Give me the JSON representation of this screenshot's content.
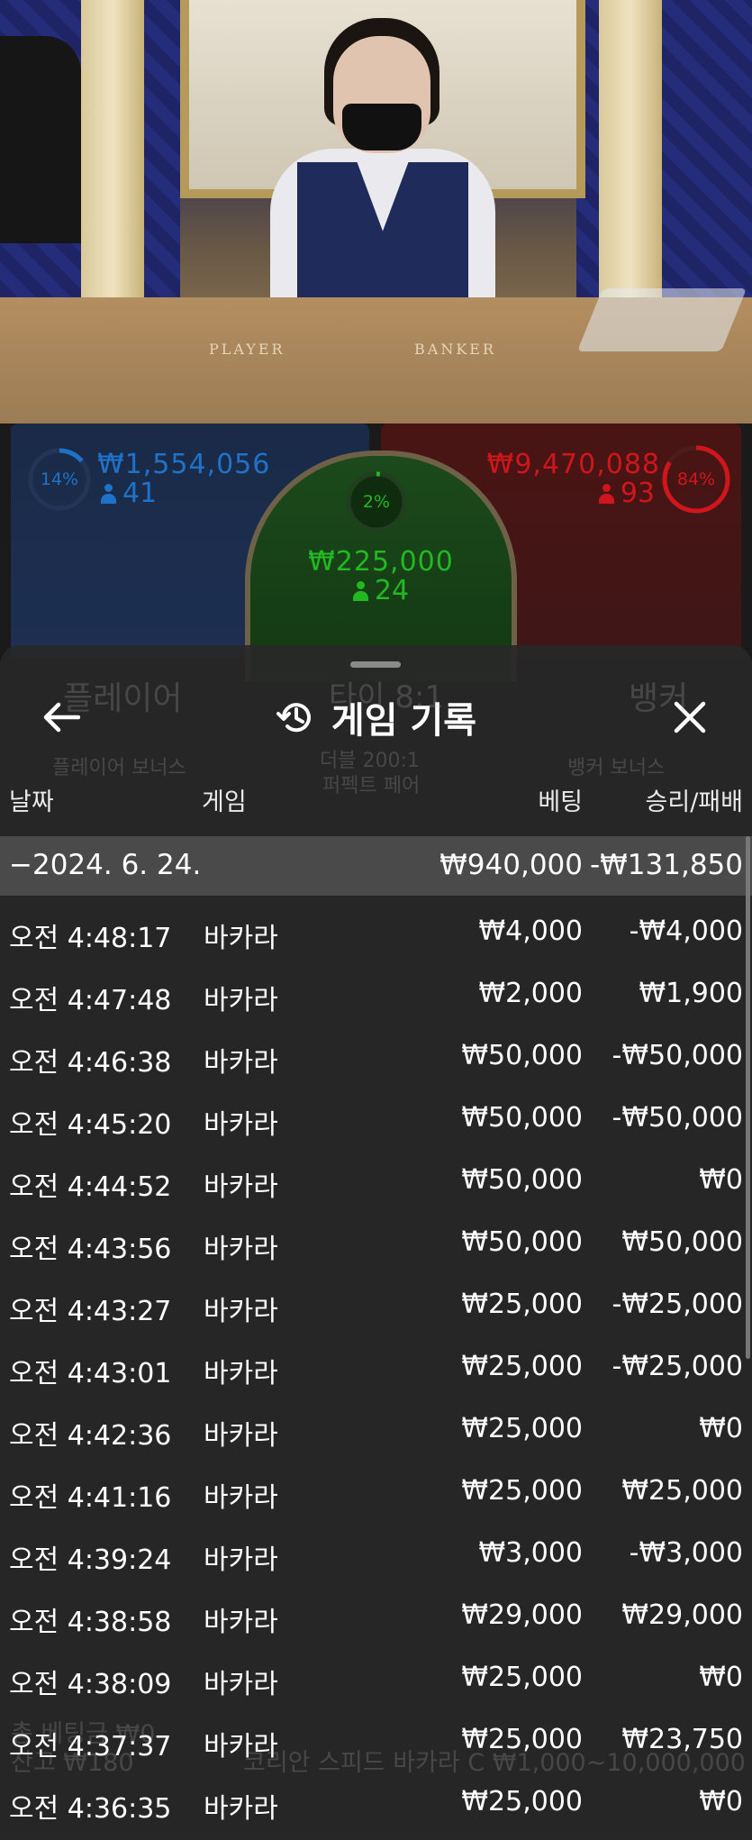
{
  "video": {
    "table_labels": {
      "player": "PLAYER",
      "banker": "BANKER"
    }
  },
  "bets": {
    "player": {
      "percent": "14%",
      "percent_value": 14,
      "amount": "₩1,554,056",
      "players": "41",
      "color": "#1e73c8"
    },
    "tie": {
      "percent": "2%",
      "percent_value": 2,
      "amount": "₩225,000",
      "players": "24",
      "color": "#22b822"
    },
    "banker": {
      "percent": "84%",
      "percent_value": 84,
      "amount": "₩9,470,088",
      "players": "93",
      "color": "#d0161c"
    }
  },
  "background_ui": {
    "player_label": "플레이어",
    "tie_label": "타이 8:1",
    "banker_label": "뱅커",
    "player_bonus": "플레이어 보너스",
    "perfect_pair": "퍼펙트 페어",
    "either_pair": "더블 200:1",
    "banker_bonus": "뱅커 보너스",
    "total_bet": "총 베팅금 ₩0",
    "balance": "잔고 ₩180",
    "table_name": "코리안 스피드 바카라 C ₩1,000~10,000,000"
  },
  "sheet": {
    "title": "게임 기록",
    "icons": {
      "back": "arrow-left-icon",
      "history": "history-icon",
      "close": "close-icon"
    },
    "columns": {
      "date": "날짜",
      "game": "게임",
      "bet": "베팅",
      "result": "승리/패배"
    },
    "date_group": {
      "label": "−2024. 6. 24.",
      "bet": "₩940,000",
      "result": "-₩131,850"
    },
    "rows": [
      {
        "time": "오전 4:48:17",
        "game": "바카라",
        "bet": "₩4,000",
        "result": "-₩4,000"
      },
      {
        "time": "오전 4:47:48",
        "game": "바카라",
        "bet": "₩2,000",
        "result": "₩1,900"
      },
      {
        "time": "오전 4:46:38",
        "game": "바카라",
        "bet": "₩50,000",
        "result": "-₩50,000"
      },
      {
        "time": "오전 4:45:20",
        "game": "바카라",
        "bet": "₩50,000",
        "result": "-₩50,000"
      },
      {
        "time": "오전 4:44:52",
        "game": "바카라",
        "bet": "₩50,000",
        "result": "₩0"
      },
      {
        "time": "오전 4:43:56",
        "game": "바카라",
        "bet": "₩50,000",
        "result": "₩50,000"
      },
      {
        "time": "오전 4:43:27",
        "game": "바카라",
        "bet": "₩25,000",
        "result": "-₩25,000"
      },
      {
        "time": "오전 4:43:01",
        "game": "바카라",
        "bet": "₩25,000",
        "result": "-₩25,000"
      },
      {
        "time": "오전 4:42:36",
        "game": "바카라",
        "bet": "₩25,000",
        "result": "₩0"
      },
      {
        "time": "오전 4:41:16",
        "game": "바카라",
        "bet": "₩25,000",
        "result": "₩25,000"
      },
      {
        "time": "오전 4:39:24",
        "game": "바카라",
        "bet": "₩3,000",
        "result": "-₩3,000"
      },
      {
        "time": "오전 4:38:58",
        "game": "바카라",
        "bet": "₩29,000",
        "result": "₩29,000"
      },
      {
        "time": "오전 4:38:09",
        "game": "바카라",
        "bet": "₩25,000",
        "result": "₩0"
      },
      {
        "time": "오전 4:37:37",
        "game": "바카라",
        "bet": "₩25,000",
        "result": "₩23,750"
      },
      {
        "time": "오전 4:36:35",
        "game": "바카라",
        "bet": "₩25,000",
        "result": "₩0"
      }
    ]
  }
}
